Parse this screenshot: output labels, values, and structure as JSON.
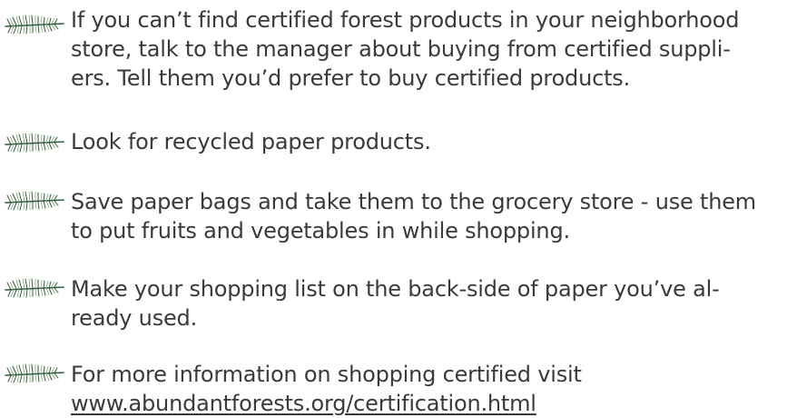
{
  "bullets": [
    {
      "icon": "pine-branch-icon",
      "lines": [
        "If you can’t find certified forest products in your neighborhood",
        "store, talk to the manager about buying from certified suppli-",
        "ers.  Tell them you’d prefer to buy certified products."
      ]
    },
    {
      "icon": "pine-branch-icon",
      "lines": [
        "Look for recycled paper products."
      ]
    },
    {
      "icon": "pine-branch-icon",
      "lines": [
        "Save paper bags and take them to the grocery store - use them",
        "to put fruits and vegetables in while shopping."
      ]
    },
    {
      "icon": "pine-branch-icon",
      "lines": [
        "Make your shopping list on the back-side of paper you’ve al-",
        "ready used."
      ]
    },
    {
      "icon": "pine-branch-icon",
      "lines": [
        "For more information on shopping certified visit"
      ],
      "link": "www.abundantforests.org/certification.html"
    }
  ],
  "colors": {
    "text": "#3a3a3a",
    "branch_dark": "#2f5a3a",
    "branch_light": "#7fa07a"
  }
}
